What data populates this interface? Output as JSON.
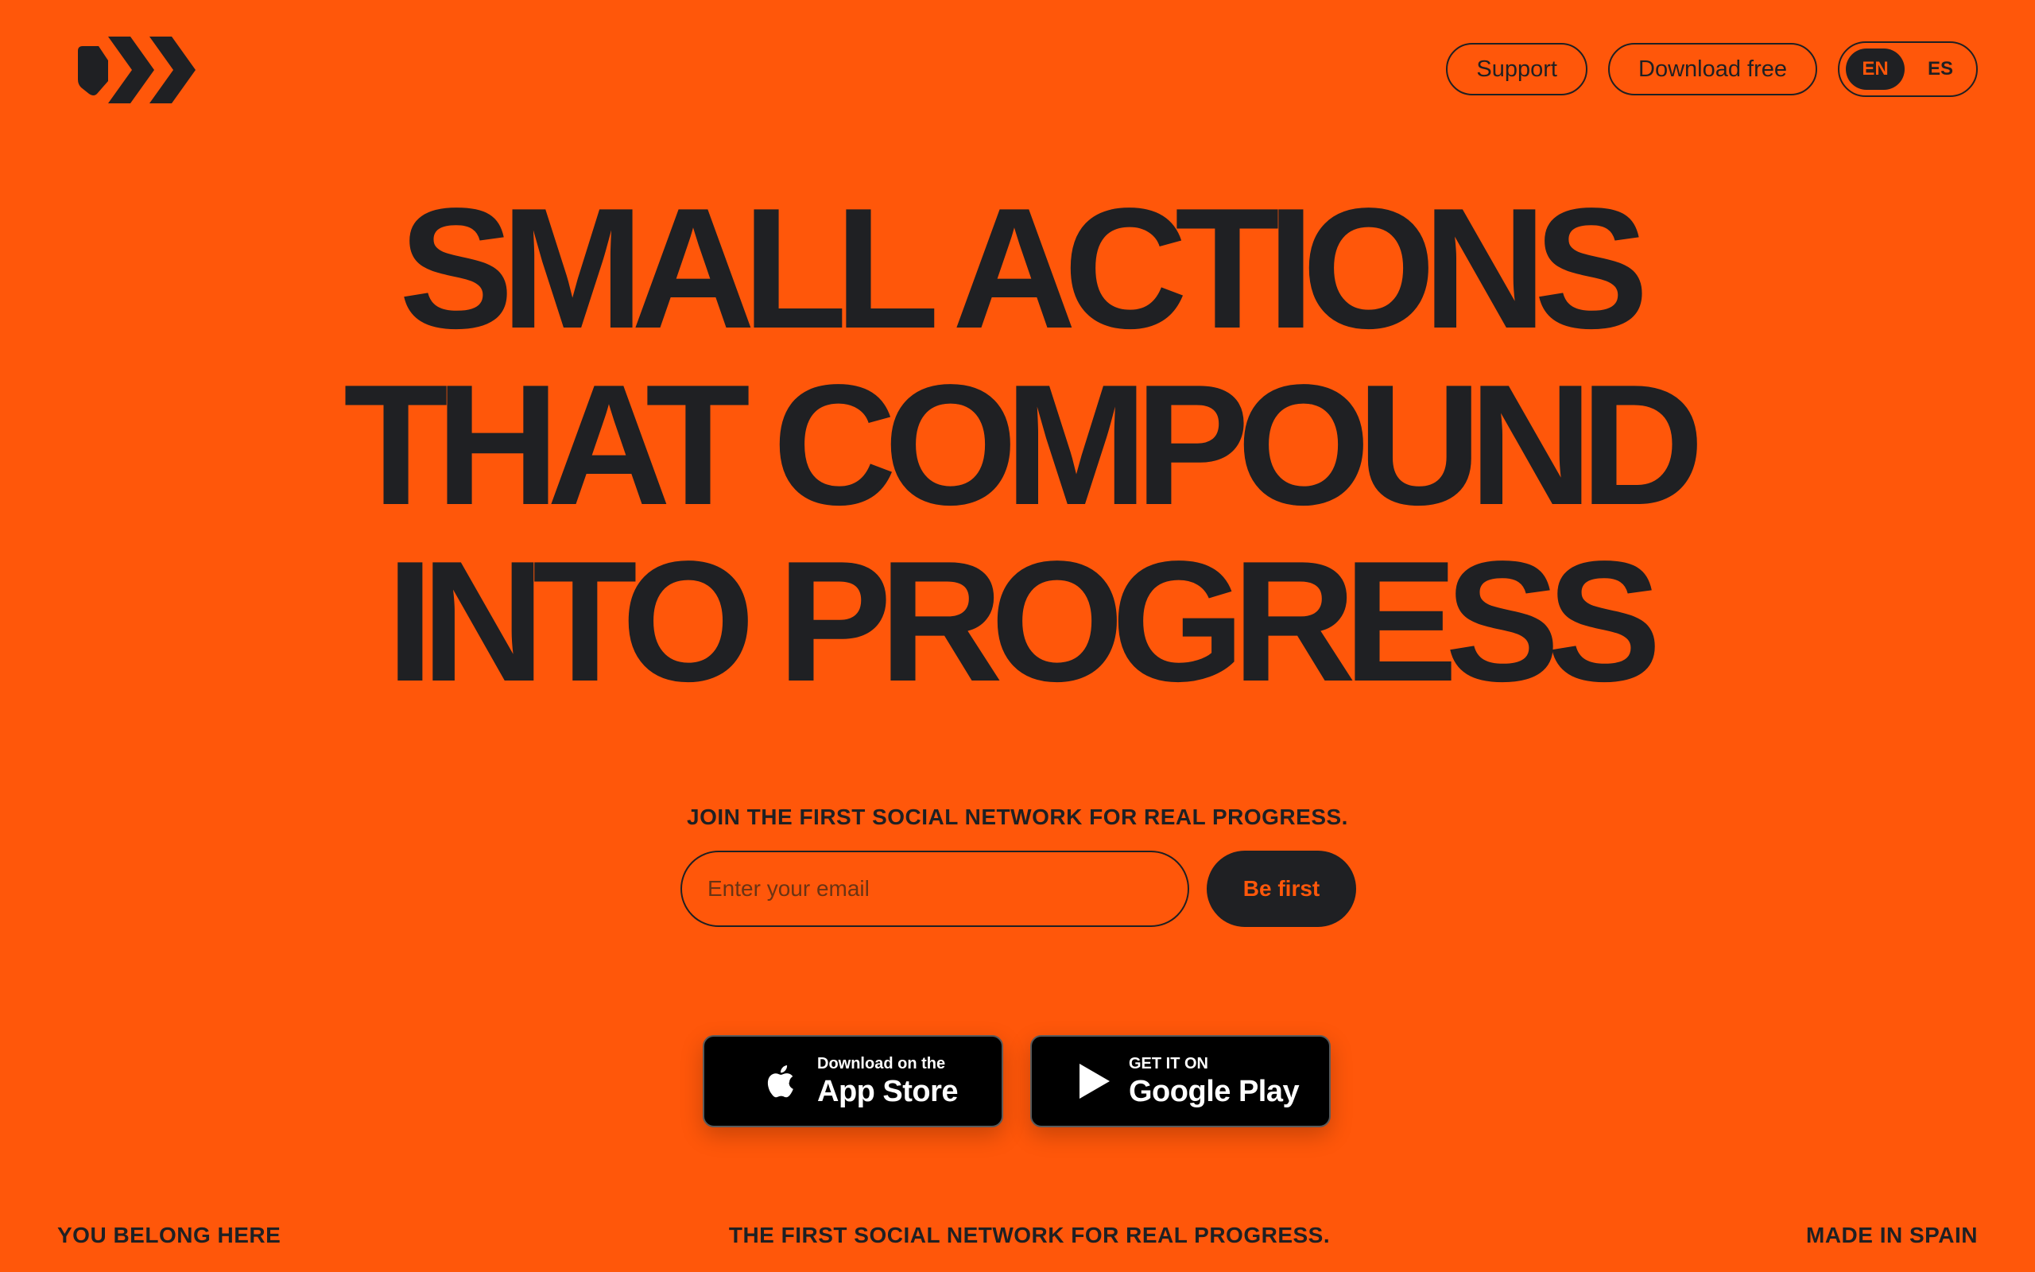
{
  "header": {
    "logo_icon": "brand-chevrons-logo",
    "nav": {
      "support_label": "Support",
      "download_label": "Download free"
    },
    "languages": [
      {
        "code": "EN",
        "active": true
      },
      {
        "code": "ES",
        "active": false
      }
    ]
  },
  "hero": {
    "headline_lines": [
      "SMALL ACTIONS",
      "THAT COMPOUND",
      "INTO PROGRESS"
    ]
  },
  "signup": {
    "label": "JOIN THE FIRST SOCIAL NETWORK FOR REAL PROGRESS.",
    "email_placeholder": "Enter your email",
    "email_value": "",
    "button_label": "Be first"
  },
  "stores": {
    "app_store": {
      "small": "Download on the",
      "big": "App Store",
      "icon": "apple-icon"
    },
    "google_play": {
      "small": "GET IT ON",
      "big": "Google Play",
      "icon": "play-icon"
    }
  },
  "footer": {
    "left": "YOU BELONG HERE",
    "center": "THE FIRST SOCIAL NETWORK FOR REAL PROGRESS.",
    "right": "MADE IN SPAIN"
  },
  "colors": {
    "background": "#FF570A",
    "text": "#1F2023",
    "badge": "#000000"
  }
}
